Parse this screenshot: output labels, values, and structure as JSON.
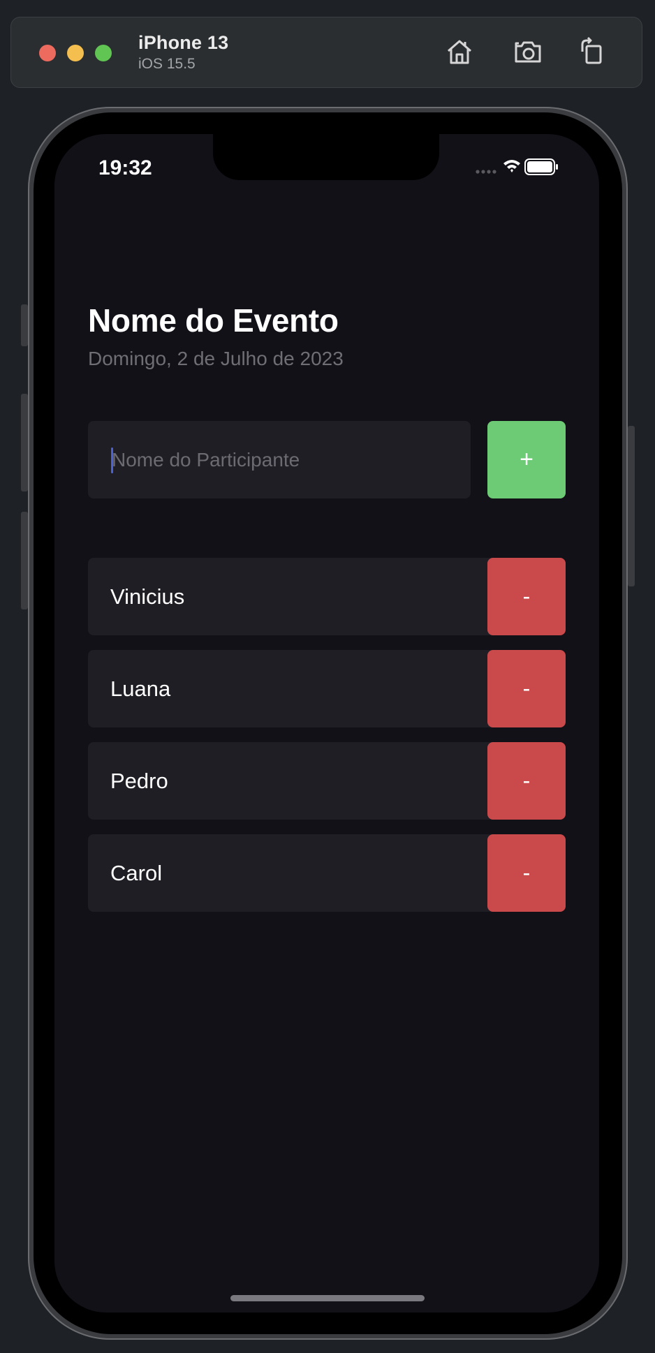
{
  "simulator": {
    "device_name": "iPhone 13",
    "os_version": "iOS 15.5",
    "icons": [
      "home-icon",
      "screenshot-icon",
      "rotate-icon"
    ]
  },
  "status_bar": {
    "time": "19:32",
    "icons": [
      "signal-icon",
      "wifi-icon",
      "battery-icon"
    ]
  },
  "event": {
    "title": "Nome do Evento",
    "date": "Domingo, 2 de Julho de 2023"
  },
  "form": {
    "placeholder": "Nome do Participante",
    "value": "",
    "add_label": "+"
  },
  "participants": [
    {
      "name": "Vinicius",
      "remove_label": "-"
    },
    {
      "name": "Luana",
      "remove_label": "-"
    },
    {
      "name": "Pedro",
      "remove_label": "-"
    },
    {
      "name": "Carol",
      "remove_label": "-"
    }
  ],
  "colors": {
    "add_button": "#6ccb74",
    "remove_button": "#ca4a4b",
    "background": "#131118",
    "field": "#1f1e25",
    "caret": "#4a62d6"
  }
}
